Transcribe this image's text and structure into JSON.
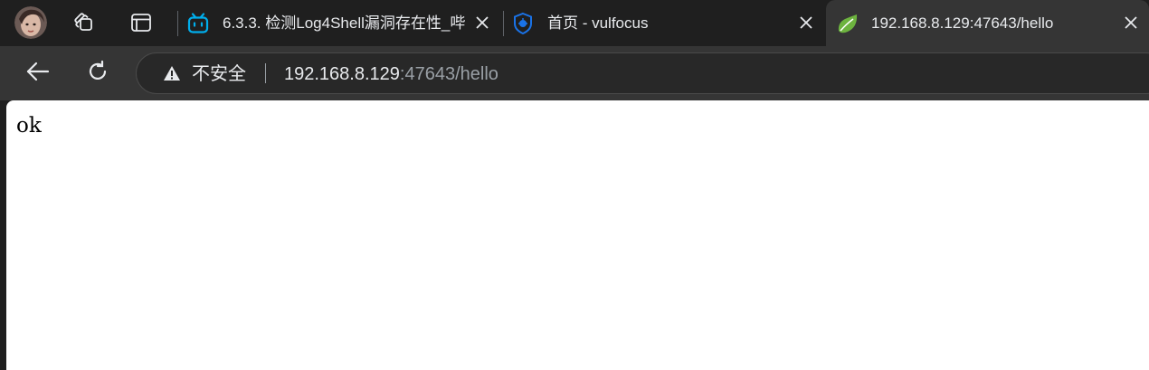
{
  "tabs": [
    {
      "title": "6.3.3. 检测Log4Shell漏洞存在性_哔",
      "favicon": "bilibili-icon"
    },
    {
      "title": "首页 - vulfocus",
      "favicon": "vulfocus-shield-icon"
    },
    {
      "title": "192.168.8.129:47643/hello",
      "favicon": "spring-leaf-icon"
    }
  ],
  "omnibox": {
    "security_label": "不安全",
    "url_host": "192.168.8.129",
    "url_rest": ":47643/hello"
  },
  "page": {
    "body_text": "ok"
  },
  "colors": {
    "tab_strip_bg": "#1f1f1f",
    "toolbar_bg": "#353535",
    "bilibili_blue": "#00aeec",
    "vulfocus_blue": "#1a73e8",
    "spring_green": "#6db33f"
  }
}
